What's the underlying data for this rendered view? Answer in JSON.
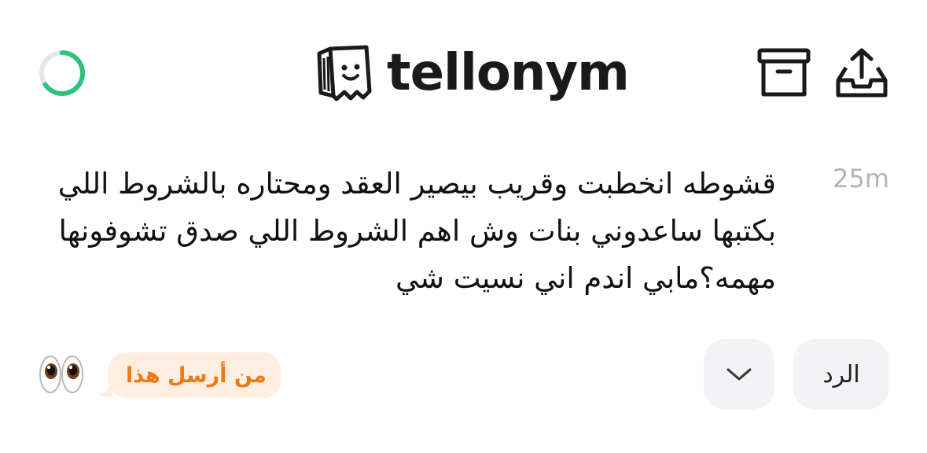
{
  "header": {
    "brand_name": "tellonym",
    "icons": {
      "loading": "loading-ring-icon",
      "archive": "archive-box-icon",
      "share": "share-tray-icon",
      "logo": "smiling-bag-logo-icon"
    }
  },
  "message": {
    "time": "25m",
    "text": "قشوطه انخطبت وقريب بيصير العقد ومحتاره بالشروط اللي بكتبها ساعدوني بنات وش اهم الشروط اللي صدق تشوفونها مهمه؟مابي اندم اني نسيت شي"
  },
  "actions": {
    "reply_label": "الرد",
    "more_icon": "chevron-down-icon",
    "who_sent_label": "من أرسل هذا",
    "eyes_icon": "eyes-emoji-icon"
  },
  "colors": {
    "spinner_green": "#2ec27e",
    "accent_orange": "#ee7a16",
    "pill_orange_bg": "#fdeee0",
    "button_gray_bg": "#f3f3f5",
    "timestamp_gray": "#b3b3b3"
  }
}
